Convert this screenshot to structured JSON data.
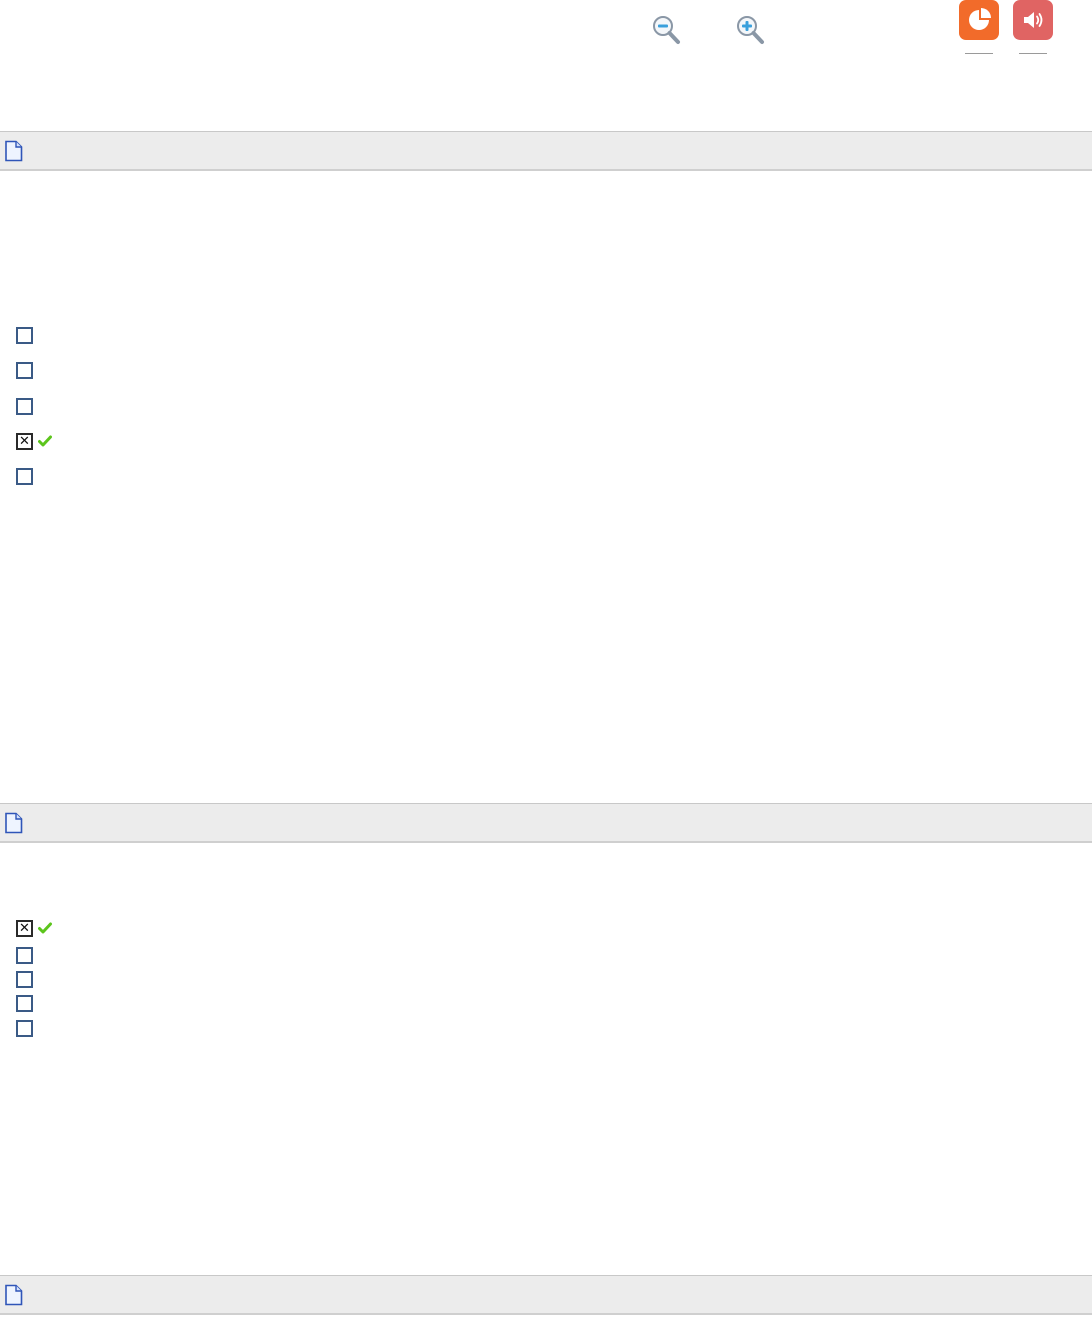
{
  "toolbar": {
    "zoom_out": {
      "icon": "zoom-out-icon"
    },
    "zoom_in": {
      "icon": "zoom-in-icon"
    },
    "results": {
      "icon": "pie-chart-icon",
      "color": "#f26b2a"
    },
    "audio": {
      "icon": "speaker-icon",
      "color": "#e06463"
    }
  },
  "sections": [
    {
      "icon": "page-icon",
      "options": [
        {
          "checked": false,
          "correct": false
        },
        {
          "checked": false,
          "correct": false
        },
        {
          "checked": false,
          "correct": false
        },
        {
          "checked": true,
          "correct": true
        },
        {
          "checked": false,
          "correct": false
        }
      ]
    },
    {
      "icon": "page-icon",
      "options": [
        {
          "checked": true,
          "correct": true
        },
        {
          "checked": false,
          "correct": false
        },
        {
          "checked": false,
          "correct": false
        },
        {
          "checked": false,
          "correct": false
        },
        {
          "checked": false,
          "correct": false
        }
      ]
    },
    {
      "icon": "page-icon",
      "options": []
    }
  ],
  "marks": {
    "checked_symbol": "✕",
    "tick_color": "#5cc51c"
  }
}
